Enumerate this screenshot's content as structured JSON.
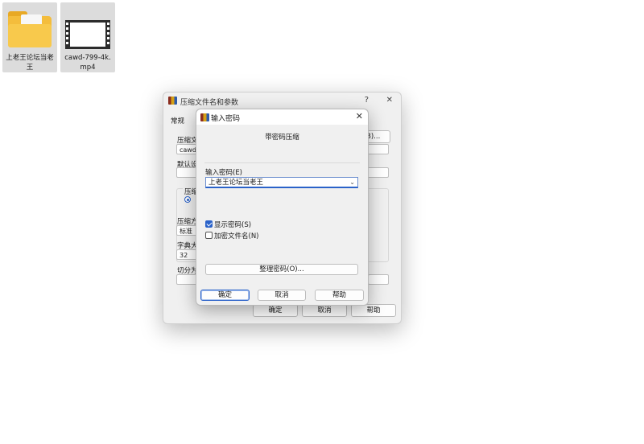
{
  "desktop": {
    "icons": [
      {
        "label": "上老王论坛当老王",
        "icon": "folder-icon"
      },
      {
        "label": "cawd-799-4k.mp4",
        "icon": "video-file-icon"
      }
    ]
  },
  "bg_dialog": {
    "title": "压缩文件名和参数",
    "help_glyph": "?",
    "close_glyph": "✕",
    "tab_general": "常规",
    "archive_label": "压缩文",
    "archive_value": "cawd-7",
    "browse_label": "(B)...",
    "profile_label": "默认设",
    "format_group_label": "压缩文",
    "method_label": "压缩方",
    "method_value": "标准",
    "dict_label": "字典大",
    "dict_value": "32",
    "split_label": "切分为",
    "ok": "确定",
    "cancel": "取消",
    "help": "帮助"
  },
  "fg_dialog": {
    "title": "输入密码",
    "close_glyph": "✕",
    "heading": "带密码压缩",
    "password_label": "输入密码(E)",
    "password_value": "上老王论坛当老王",
    "show_password_label": "显示密码(S)",
    "show_password_checked": true,
    "encrypt_names_label": "加密文件名(N)",
    "encrypt_names_checked": false,
    "organize_button": "整理密码(O)...",
    "ok": "确定",
    "cancel": "取消",
    "help": "帮助"
  }
}
